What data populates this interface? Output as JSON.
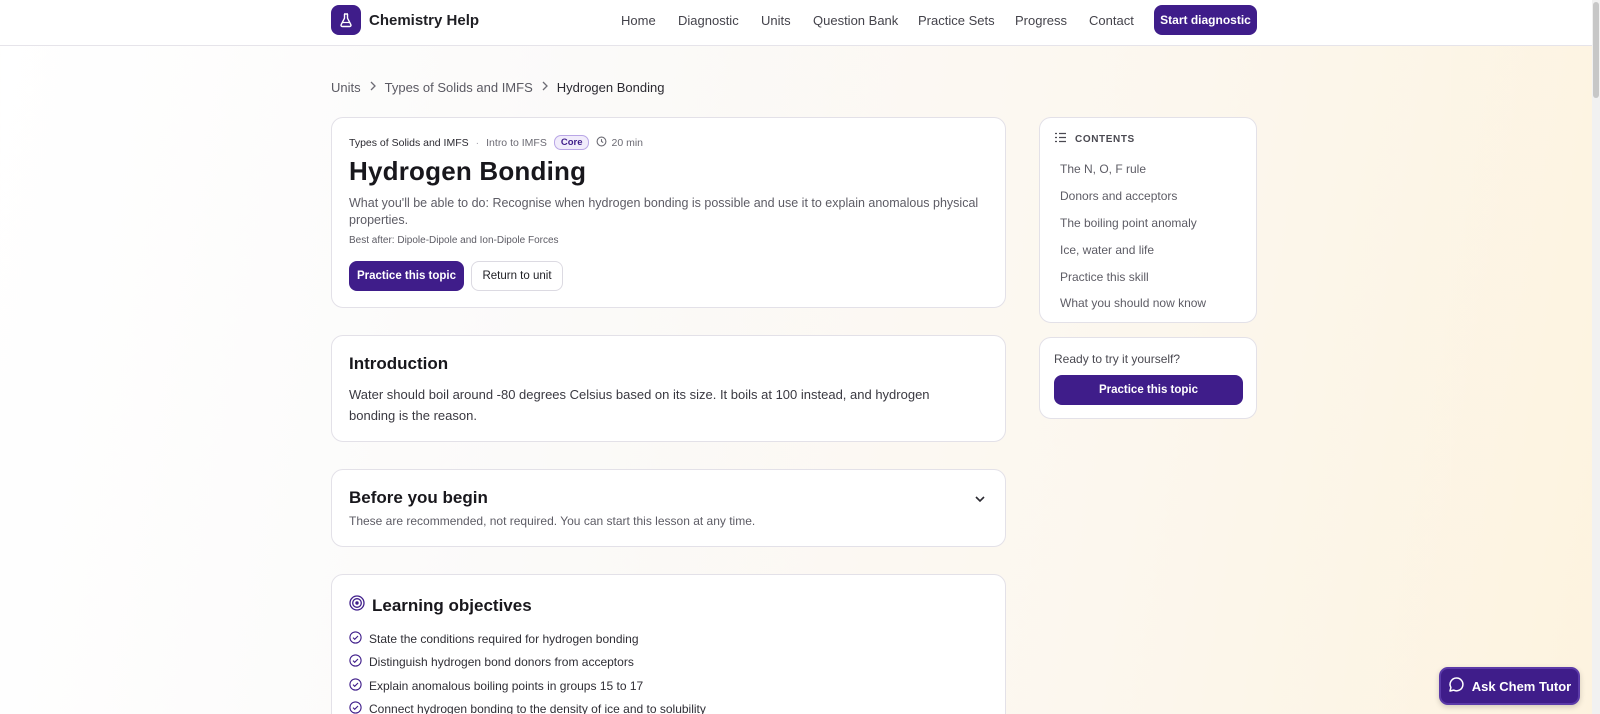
{
  "header": {
    "brand": "Chemistry Help",
    "nav": [
      "Home",
      "Diagnostic",
      "Units",
      "Question Bank",
      "Practice Sets",
      "Progress",
      "Contact"
    ],
    "cta": "Start diagnostic"
  },
  "breadcrumb": {
    "items": [
      "Units",
      "Types of Solids and IMFS"
    ],
    "current": "Hydrogen Bonding"
  },
  "hero": {
    "unit": "Types of Solids and IMFS",
    "subunit": "Intro to IMFS",
    "badge": "Core",
    "duration": "20 min",
    "title": "Hydrogen Bonding",
    "description": "What you'll be able to do: Recognise when hydrogen bonding is possible and use it to explain anomalous physical properties.",
    "best_after": "Best after: Dipole-Dipole and Ion-Dipole Forces",
    "primary_button": "Practice this topic",
    "secondary_button": "Return to unit"
  },
  "introduction": {
    "title": "Introduction",
    "body": "Water should boil around -80 degrees Celsius based on its size. It boils at 100 instead, and hydrogen bonding is the reason."
  },
  "before": {
    "title": "Before you begin",
    "subtitle": "These are recommended, not required. You can start this lesson at any time."
  },
  "objectives": {
    "title": "Learning objectives",
    "items": [
      "State the conditions required for hydrogen bonding",
      "Distinguish hydrogen bond donors from acceptors",
      "Explain anomalous boiling points in groups 15 to 17",
      "Connect hydrogen bonding to the density of ice and to solubility"
    ]
  },
  "contents": {
    "heading": "CONTENTS",
    "items": [
      "The N, O, F rule",
      "Donors and acceptors",
      "The boiling point anomaly",
      "Ice, water and life",
      "Practice this skill",
      "What you should now know"
    ]
  },
  "try": {
    "text": "Ready to try it yourself?",
    "button": "Practice this topic"
  },
  "chat": {
    "label": "Ask Chem Tutor"
  },
  "colors": {
    "accent": "#3f1d8a",
    "badge_border": "#b9a6e6"
  }
}
